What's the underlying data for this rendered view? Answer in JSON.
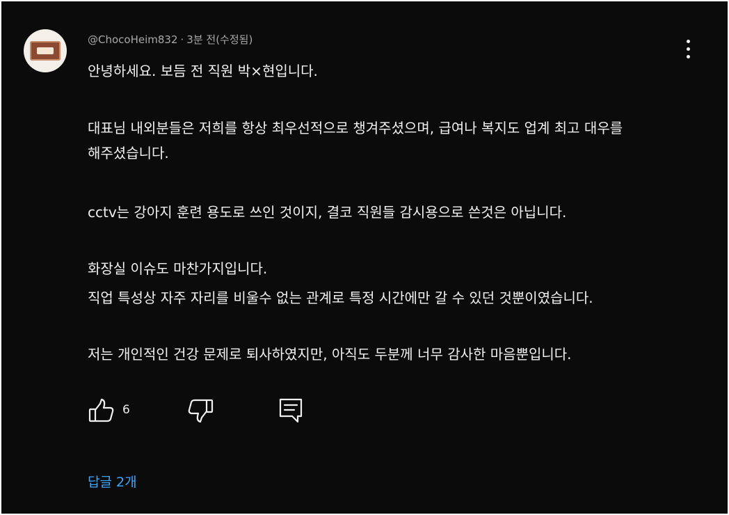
{
  "comment": {
    "author": "@ChocoHeim832",
    "separator": "·",
    "time": "3분 전(수정됨)",
    "avatar": "chocolate-snack-package-avatar",
    "paragraphs": [
      "안녕하세요. 보듬 전 직원 박×현입니다.",
      "대표님 내외분들은 저희를 항상 최우선적으로 챙겨주셨으며, 급여나 복지도 업계 최고 대우를",
      "해주셨습니다.",
      "cctv는 강아지 훈련 용도로 쓰인 것이지, 결코 직원들 감시용으로 쓴것은 아닙니다.",
      "화장실 이슈도 마찬가지입니다.",
      "직업 특성상 자주 자리를 비울수 없는 관계로 특정 시간에만 갈 수 있던 것뿐이였습니다.",
      "저는 개인적인 건강 문제로 퇴사하였지만, 아직도 두분께 너무 감사한 마음뿐입니다."
    ]
  },
  "actions": {
    "like_icon": "thumbs-up-icon",
    "like_count": "6",
    "dislike_icon": "thumbs-down-icon",
    "reply_icon": "reply-icon"
  },
  "replies": {
    "label": "답글 2개"
  },
  "colors": {
    "background": "#0b0b0b",
    "text": "#f1f1f1",
    "meta": "#a9a9a9",
    "link": "#3ea6ff"
  }
}
